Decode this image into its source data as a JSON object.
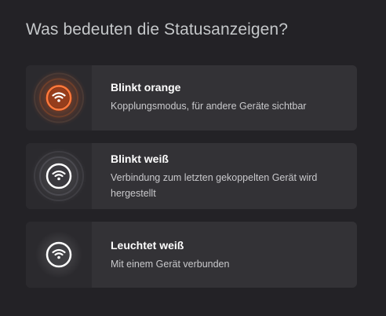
{
  "header": {
    "title": "Was bedeuten die Statusanzeigen?"
  },
  "status_cards": [
    {
      "title": "Blinkt orange",
      "description": "Kopplungsmodus, für andere Geräte sichtbar",
      "icon": "wifi-pairing-icon",
      "color": "#ff7a3d"
    },
    {
      "title": "Blinkt weiß",
      "description": "Verbindung zum letzten gekoppelten Gerät wird hergestellt",
      "icon": "wifi-connecting-icon",
      "color": "#ffffff"
    },
    {
      "title": "Leuchtet weiß",
      "description": "Mit einem Gerät verbunden",
      "icon": "wifi-connected-icon",
      "color": "#ffffff"
    }
  ],
  "colors": {
    "background": "#232226",
    "card": "#333236",
    "icon_panel": "#2b2a2e",
    "title": "#c4c7c9",
    "orange_accent": "#ff7a3d"
  }
}
